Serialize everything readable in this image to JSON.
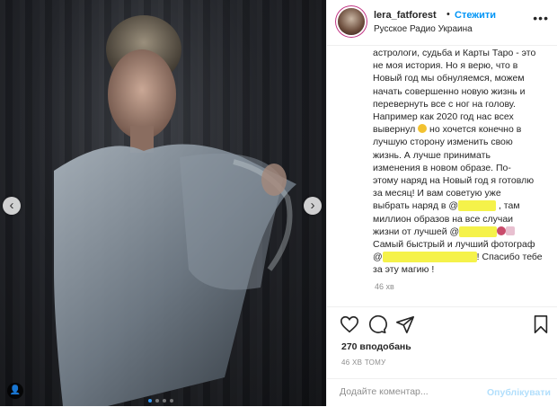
{
  "post": {
    "nav_prev": "‹",
    "nav_next": "›",
    "tag_icon": "👤"
  },
  "header": {
    "username": "lera_fatforest",
    "separator": "•",
    "follow_label": "Стежити",
    "location": "Русское Радио Украина",
    "more_icon": "•••"
  },
  "caption": {
    "lines": [
      "астрологи, судьба и Карты Таро - это",
      "не моя история. Но я верю, что в",
      "Новый год мы обнуляемся, можем",
      "начать совершенно новую жизнь и",
      "перевернуть все с ног на голову.",
      "Например как 2020 год нас всех",
      "вывернул",
      " но хочется конечно в",
      "лучшую сторону изменить свою",
      "жизнь. А лучше принимать",
      "изменения в новом образе. По-",
      "этому наряд на Новый год я готовлю",
      "за месяц! И вам советую уже",
      "выбрать наряд в @",
      " , там",
      "миллион образов на все случаи",
      "жизни от лучшей @",
      "Самый быстрый и лучший фотограф",
      "@",
      "! Спасибо тебе",
      "за эту магию !"
    ],
    "time": "46 хв"
  },
  "stats": {
    "likes": "270 вподобань",
    "ago": "46 ХВ ТОМУ"
  },
  "comment": {
    "placeholder": "Додайте коментар...",
    "publish_label": "Опублікувати"
  },
  "colors": {
    "accent": "#0095f6",
    "publish_disabled": "#b2dffc",
    "highlight": "#f5f24a"
  }
}
